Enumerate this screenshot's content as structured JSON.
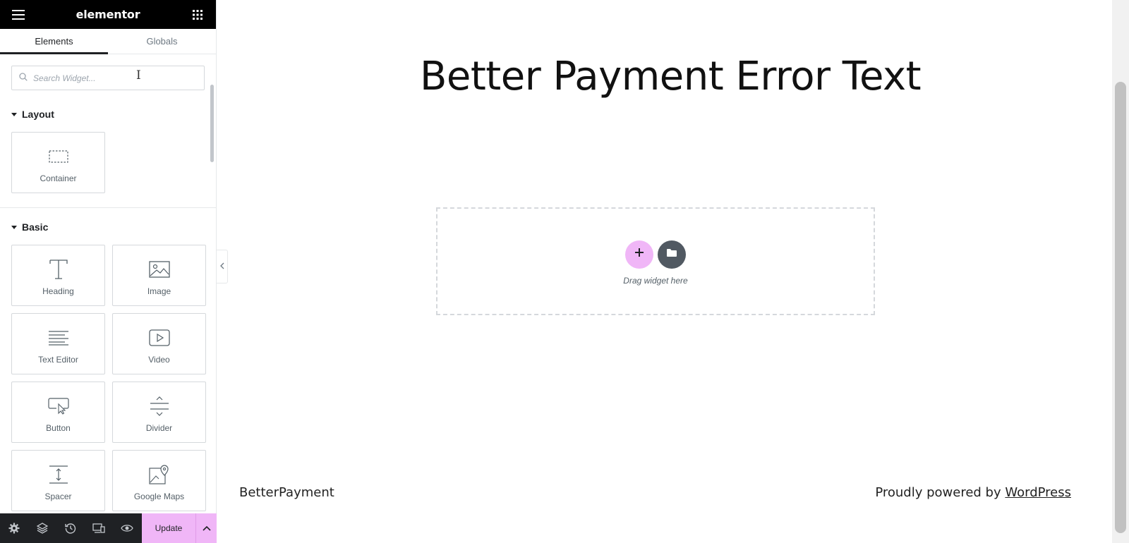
{
  "header": {
    "logo": "elementor",
    "menu_icon": "hamburger-icon",
    "apps_icon": "grid-apps-icon"
  },
  "tabs": [
    {
      "label": "Elements",
      "active": true
    },
    {
      "label": "Globals",
      "active": false
    }
  ],
  "search": {
    "placeholder": "Search Widget...",
    "value": "",
    "icon": "search-icon"
  },
  "categories": [
    {
      "title": "Layout",
      "widgets": [
        {
          "label": "Container",
          "icon": "container-icon"
        }
      ]
    },
    {
      "title": "Basic",
      "widgets": [
        {
          "label": "Heading",
          "icon": "heading-icon"
        },
        {
          "label": "Image",
          "icon": "image-icon"
        },
        {
          "label": "Text Editor",
          "icon": "text-editor-icon"
        },
        {
          "label": "Video",
          "icon": "video-icon"
        },
        {
          "label": "Button",
          "icon": "button-icon"
        },
        {
          "label": "Divider",
          "icon": "divider-icon"
        },
        {
          "label": "Spacer",
          "icon": "spacer-icon"
        },
        {
          "label": "Google Maps",
          "icon": "google-maps-icon"
        }
      ]
    }
  ],
  "footer": {
    "update_label": "Update",
    "tools": [
      "settings-icon",
      "layers-icon",
      "history-icon",
      "responsive-icon",
      "preview-eye-icon"
    ],
    "accent": "#f0b6f7"
  },
  "page": {
    "title": "Better Payment Error Text",
    "drop_hint": "Drag widget here",
    "site_name": "BetterPayment",
    "powered_prefix": "Proudly powered by ",
    "powered_link": "WordPress"
  },
  "colors": {
    "panel_header": "#000000",
    "accent_pink": "#f0b6f7",
    "template_button": "#515962",
    "footer_bar": "#1f2124"
  }
}
